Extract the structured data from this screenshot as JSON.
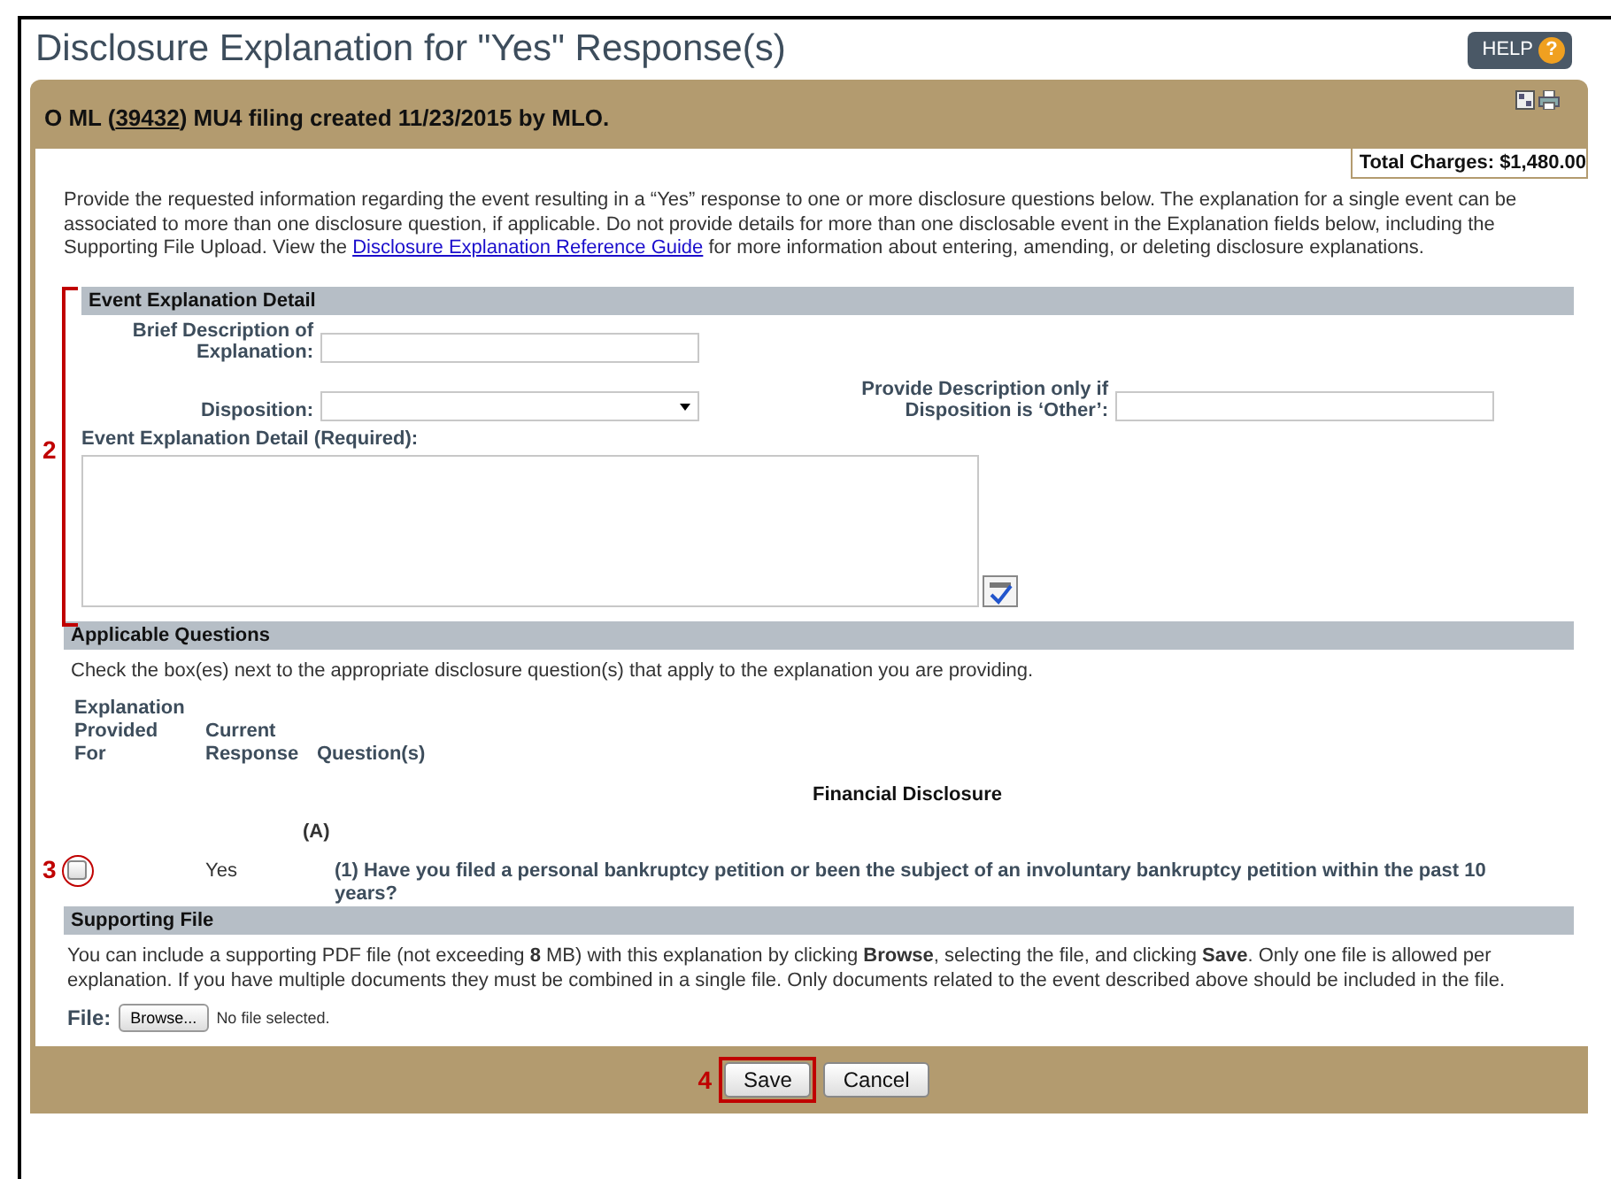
{
  "page_title": "Disclosure Explanation for \"Yes\" Response(s)",
  "help_button": {
    "label": "HELP",
    "icon": "?"
  },
  "header": {
    "prefix": "O ML (",
    "id_link": "39432",
    "suffix": ") MU4 filing created 11/23/2015 by MLO."
  },
  "total_charges": "Total Charges: $1,480.00",
  "intro": {
    "before": "Provide the requested information regarding the event resulting in a “Yes” response to one or more disclosure questions below. The explanation for a single event can be associated to more than one disclosure question, if applicable. Do not provide details for more than one disclosable event in the Explanation fields below, including the Supporting File Upload. View the ",
    "link": "Disclosure Explanation Reference Guide",
    "after": " for more information about entering, amending, or deleting disclosure explanations."
  },
  "event_section": {
    "title": "Event Explanation Detail",
    "brief_label": "Brief Description of Explanation:",
    "disposition_label": "Disposition:",
    "other_label": "Provide Description only if Disposition is ‘Other’:",
    "detail_label": "Event Explanation Detail (Required):"
  },
  "questions_section": {
    "title": "Applicable Questions",
    "instruction": "Check the box(es) next to the appropriate disclosure question(s) that apply to the explanation you are providing.",
    "columns": [
      "Explanation Provided For",
      "Current Response",
      "Question(s)"
    ],
    "group": "Financial Disclosure",
    "subgroup": "(A)",
    "rows": [
      {
        "checked": false,
        "response": "Yes",
        "question": "(1) Have you filed a personal bankruptcy petition or been the subject of an involuntary bankruptcy petition within the past 10 years?"
      }
    ]
  },
  "file_section": {
    "title": "Supporting File",
    "text": "You can include a supporting PDF file (not exceeding **8** MB) with this explanation by clicking **Browse**, selecting the file, and clicking **Save**. Only one file is allowed per explanation. If you have multiple documents they must be combined in a single file. Only documents related to the event described above should be included in the file.",
    "file_label": "File:",
    "browse": "Browse...",
    "no_file": "No file selected."
  },
  "buttons": [
    {
      "label": "Save",
      "highlighted": true
    },
    {
      "label": "Cancel",
      "highlighted": false
    }
  ],
  "annotations": [
    "2",
    "3",
    "4"
  ]
}
